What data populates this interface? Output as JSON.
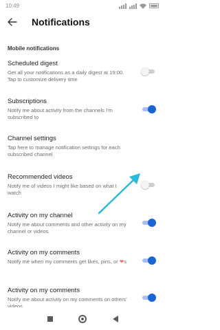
{
  "status_bar": {
    "time": "10:49"
  },
  "toolbar": {
    "title": "Notifications"
  },
  "section_header": "Mobile notifications",
  "items": [
    {
      "title": "Scheduled digest",
      "desc": "Get all your notifications as a daily digest at 19:00. Tap to customize delivery time",
      "toggle": "off"
    },
    {
      "title": "Subscriptions",
      "desc": "Notify me about activity from the channels I'm subscribed to",
      "toggle": "on"
    },
    {
      "title": "Channel settings",
      "desc": "Tap here to manage notification settings for each subscribed channel",
      "toggle": null
    },
    {
      "title": "Recommended videos",
      "desc": "Notify me of videos I might like based on what I watch",
      "toggle": "off"
    },
    {
      "title": "Activity on my channel",
      "desc": "Notify me about comments and other activity on my channel or videos",
      "toggle": "on"
    },
    {
      "title": "Activity on my comments",
      "desc_before": "Notify me when my comments get likes, pins, or ",
      "desc_after": "s",
      "toggle": "on"
    },
    {
      "title": "Activity on my comments",
      "desc": "Notify me about activity on my comments on others' videos",
      "toggle": "on"
    }
  ],
  "heart_glyph": "❤",
  "colors": {
    "toggle_on": "#1a64d6",
    "toggle_off": "#f4f4f4",
    "annotation_arrow": "#2bb9d8"
  }
}
